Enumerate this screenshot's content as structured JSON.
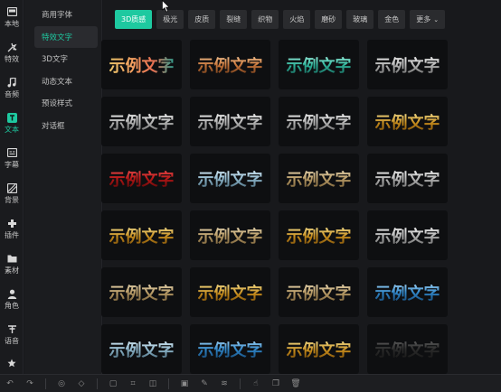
{
  "rail": {
    "items": [
      {
        "label": "本地",
        "icon": "folder-icon"
      },
      {
        "label": "特效",
        "icon": "effects-icon"
      },
      {
        "label": "音频",
        "icon": "music-note-icon"
      },
      {
        "label": "文本",
        "icon": "text-icon"
      },
      {
        "label": "字幕",
        "icon": "subtitle-icon"
      },
      {
        "label": "背景",
        "icon": "background-icon"
      },
      {
        "label": "插件",
        "icon": "plugin-icon"
      },
      {
        "label": "素材",
        "icon": "assets-folder-icon"
      },
      {
        "label": "角色",
        "icon": "person-icon"
      },
      {
        "label": "语音",
        "icon": "voice-icon"
      }
    ],
    "active_index": 3
  },
  "categories": {
    "items": [
      "商用字体",
      "特效文字",
      "3D文字",
      "动态文本",
      "预设样式",
      "对话框"
    ],
    "active_index": 1
  },
  "tabs": {
    "items": [
      "3D质感",
      "极光",
      "皮质",
      "裂缝",
      "织物",
      "火焰",
      "磨砂",
      "玻璃",
      "金色"
    ],
    "more_label": "更多",
    "active_index": 0
  },
  "grid": {
    "sample_text": "示例文字",
    "styles": [
      "s-multi",
      "s-rose",
      "s-teal",
      "s-silver",
      "s-silver",
      "s-silver",
      "s-silver",
      "s-gold",
      "s-red",
      "s-ice",
      "s-warm",
      "s-silver",
      "s-gold",
      "s-warm",
      "s-gold",
      "s-silver",
      "s-warm",
      "s-gold",
      "s-warm",
      "s-blue",
      "s-ice",
      "s-blue",
      "s-gold",
      "s-dark"
    ]
  },
  "colors": {
    "accent": "#1ec9a0",
    "background": "#17181b",
    "card": "#0e0f11"
  }
}
